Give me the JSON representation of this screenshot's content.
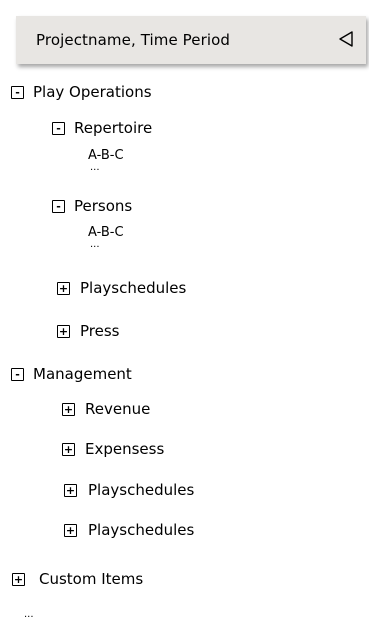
{
  "header": {
    "title": "Projectname, Time Period",
    "collapse_icon": "triangle-left-icon"
  },
  "tree": {
    "play_operations": {
      "toggle": "-",
      "label": "Play Operations"
    },
    "repertoire": {
      "toggle": "-",
      "label": "Repertoire",
      "items": [
        "A-B-C",
        "..."
      ]
    },
    "persons": {
      "toggle": "-",
      "label": "Persons",
      "items": [
        "A-B-C",
        "..."
      ]
    },
    "playschedules_1": {
      "toggle": "+",
      "label": "Playschedules"
    },
    "press": {
      "toggle": "+",
      "label": "Press"
    },
    "management": {
      "toggle": "-",
      "label": "Management"
    },
    "revenue": {
      "toggle": "+",
      "label": "Revenue"
    },
    "expenses": {
      "toggle": "+",
      "label": "Expensess"
    },
    "playschedules_2": {
      "toggle": "+",
      "label": "Playschedules"
    },
    "playschedules_3": {
      "toggle": "+",
      "label": "Playschedules"
    },
    "custom_items": {
      "toggle": "+",
      "label": "Custom Items"
    },
    "trailing": "..."
  }
}
